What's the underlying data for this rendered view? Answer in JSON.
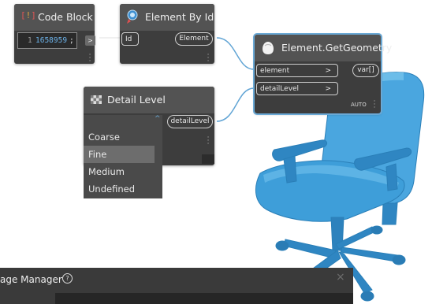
{
  "code_block": {
    "title": "Code Block",
    "title_icon": "curly-braces-icon",
    "line_number": "1",
    "code_value": "1658959",
    "code_terminator": ";",
    "output_arrow": ">"
  },
  "element_by_id": {
    "title": "Element By Id",
    "title_icon": "element-search-icon",
    "input_port": "Id",
    "output_port": "Element"
  },
  "get_geometry": {
    "title": "Element.GetGeometry",
    "title_icon": "geometry-blob-icon",
    "inputs": [
      {
        "label": "element",
        "arrow": ">"
      },
      {
        "label": "detailLevel",
        "arrow": ">"
      }
    ],
    "output_port": "var[]",
    "lacing": "AUTO"
  },
  "detail_level": {
    "title": "Detail Level",
    "title_icon": "checker-icon",
    "output_port": "detailLevel",
    "dropdown_options": [
      "Coarse",
      "Fine",
      "Medium",
      "Undefined"
    ],
    "selected": "Fine"
  },
  "package_manager": {
    "title_partial": "age Manager",
    "help_glyph": "?",
    "close_glyph": "×"
  },
  "colors": {
    "node_body": "#3d3d3d",
    "node_header": "#535353",
    "wire": "#62a5d5",
    "chair": "#3a98d4",
    "selection": "#6aa9d6",
    "code_value_text": "#6cb2e8"
  }
}
